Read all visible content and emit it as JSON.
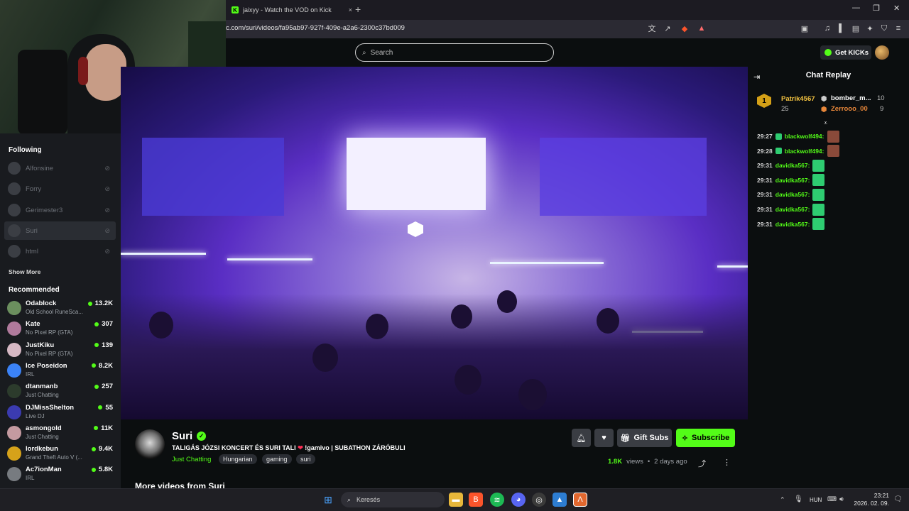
{
  "browser": {
    "tab_title": "jaixyy - Watch the VOD on Kick",
    "tab_close": "×",
    "new_tab": "+",
    "url": "c.com/suri/videos/fa95ab97-927f-409e-a2a6-2300c37bd009",
    "window_controls": [
      "—",
      "❐",
      "✕"
    ]
  },
  "header": {
    "search_placeholder": "Search",
    "get_kicks_label": "Get KICKs"
  },
  "sidebar": {
    "following_heading": "Following",
    "following": [
      {
        "name": "Alfonsine"
      },
      {
        "name": "Forry"
      },
      {
        "name": "Gerimester3"
      },
      {
        "name": "Suri"
      },
      {
        "name": "html"
      }
    ],
    "show_more": "Show More",
    "recommended_heading": "Recommended",
    "recommended": [
      {
        "name": "Odablock",
        "category": "Old School RuneSca...",
        "viewers": "13.2K",
        "color": "#6b8f5e"
      },
      {
        "name": "Kate",
        "category": "No Pixel RP (GTA)",
        "viewers": "307",
        "color": "#b07a9c"
      },
      {
        "name": "JustKiku",
        "category": "No Pixel RP (GTA)",
        "viewers": "139",
        "color": "#d6b8c4"
      },
      {
        "name": "Ice Poseidon",
        "category": "IRL",
        "viewers": "8.2K",
        "color": "#3b82f6"
      },
      {
        "name": "dtanmanb",
        "category": "Just Chatting",
        "viewers": "257",
        "color": "#2c3b2c"
      },
      {
        "name": "DJMissShelton",
        "category": "Live DJ",
        "viewers": "55",
        "color": "#3b3bb0"
      },
      {
        "name": "asmongold",
        "category": "Just Chatting",
        "viewers": "11K",
        "color": "#c49aa0"
      },
      {
        "name": "lordkebun",
        "category": "Grand Theft Auto V (...",
        "viewers": "9.4K",
        "color": "#d6a21a"
      },
      {
        "name": "Ac7ionMan",
        "category": "IRL",
        "viewers": "5.8K",
        "color": "#777b80"
      }
    ]
  },
  "channel": {
    "name": "Suri",
    "title_part1": "TALIGÁS JÓZSI KONCERT ÉS SURI TALI",
    "title_heart": "❤",
    "title_part2": "!gamivo | SUBATHON ZÁRÓBULI",
    "category": "Just Chatting",
    "tags": [
      "Hungarian",
      "gaming",
      "suri"
    ],
    "gift_subs": "Gift Subs",
    "subscribe": "Subscribe",
    "views_num": "1.8K",
    "views_word": "views",
    "age": "2 days ago",
    "more_videos": "More videos from Suri"
  },
  "chat": {
    "heading": "Chat Replay",
    "leaders": [
      {
        "rank": "1",
        "name": "Patrik4567",
        "count": "25"
      },
      {
        "name": "bomber_m...",
        "count": "10"
      },
      {
        "name": "Zerrooo_00",
        "count": "9"
      }
    ],
    "messages": [
      {
        "time": "29:27",
        "user": "blackwolf494:",
        "emote": "#8a4a3a"
      },
      {
        "time": "29:28",
        "user": "blackwolf494:",
        "emote": "#8a4a3a"
      },
      {
        "time": "29:31",
        "user": "davidka567:",
        "emote": "#2ecc71"
      },
      {
        "time": "29:31",
        "user": "davidka567:",
        "emote": "#2ecc71"
      },
      {
        "time": "29:31",
        "user": "davidka567:",
        "emote": "#2ecc71"
      },
      {
        "time": "29:31",
        "user": "davidka567:",
        "emote": "#2ecc71"
      },
      {
        "time": "29:31",
        "user": "davidka567:",
        "emote": "#2ecc71"
      }
    ]
  },
  "taskbar": {
    "search_placeholder": "Keresés",
    "language": "HUN",
    "time": "23:21",
    "date": "2026. 02. 09."
  },
  "colors": {
    "kick_green": "#53fc18",
    "sidebar_bg": "#191b1f",
    "page_bg": "#0b0e0f"
  }
}
